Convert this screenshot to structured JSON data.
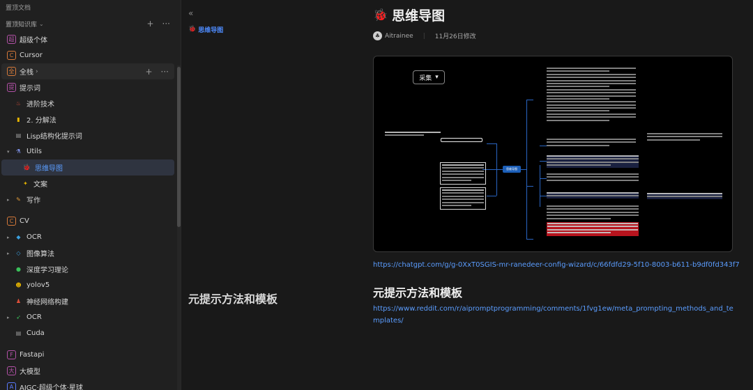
{
  "sidebar": {
    "top_label": "置顶文档",
    "kb_title": "置顶知识库",
    "items": [
      {
        "label": "超级个体",
        "icon": "超",
        "icon_name": "cjgt-kb-icon",
        "color": "#b452a8"
      },
      {
        "label": "Cursor",
        "icon": "C",
        "icon_name": "cursor-kb-icon",
        "color": "#d77a3a"
      },
      {
        "label": "全栈",
        "icon": "全",
        "icon_name": "qz-kb-icon",
        "color": "#d77a3a"
      },
      {
        "label": "提示词",
        "icon": "提",
        "icon_name": "tsc-kb-icon",
        "color": "#b452a8"
      },
      {
        "label": "进阶技术",
        "icon": "♨",
        "icon_name": "fire-icon",
        "color": "#e0503a"
      },
      {
        "label": "2. 分解法",
        "icon": "▮",
        "icon_name": "note-icon",
        "color": "#e6b400"
      },
      {
        "label": "Lisp结构化提示词",
        "icon": "▤",
        "icon_name": "doc-icon",
        "color": "#9a9a9a"
      },
      {
        "label": "Utils",
        "icon": "⚗",
        "icon_name": "flask-icon",
        "color": "#8aa0ff"
      },
      {
        "label": "思维导图",
        "icon": "🐞",
        "icon_name": "ladybug-icon",
        "color": "#e0503a"
      },
      {
        "label": "文案",
        "icon": "✦",
        "icon_name": "sparkle-icon",
        "color": "#e6b400"
      },
      {
        "label": "写作",
        "icon": "✎",
        "icon_name": "camel-icon",
        "color": "#e09a3a"
      },
      {
        "label": "CV",
        "icon": "C",
        "icon_name": "cv-kb-icon",
        "color": "#d77a3a"
      },
      {
        "label": "OCR",
        "icon": "◆",
        "icon_name": "drop-icon",
        "color": "#3aa0e0"
      },
      {
        "label": "图像算法",
        "icon": "◇",
        "icon_name": "shapes-icon",
        "color": "#3aa0e0"
      },
      {
        "label": "深度学习理论",
        "icon": "●",
        "icon_name": "circle-icon",
        "color": "#3ac05a"
      },
      {
        "label": "yolov5",
        "icon": "☻",
        "icon_name": "face-icon",
        "color": "#e6b400"
      },
      {
        "label": "神经网络构建",
        "icon": "♟",
        "icon_name": "bell-icon",
        "color": "#e0503a"
      },
      {
        "label": "OCR",
        "icon": "➶",
        "icon_name": "runner-icon",
        "color": "#3ac05a"
      },
      {
        "label": "Cuda",
        "icon": "▤",
        "icon_name": "doc-icon",
        "color": "#9a9a9a"
      },
      {
        "label": "Fastapi",
        "icon": "F",
        "icon_name": "fastapi-kb-icon",
        "color": "#b452a8"
      },
      {
        "label": "大模型",
        "icon": "大",
        "icon_name": "dmx-kb-icon",
        "color": "#b452a8"
      },
      {
        "label": "AIGC·超级个体·星球",
        "icon": "A",
        "icon_name": "aigc-kb-icon",
        "color": "#5b7bff"
      }
    ]
  },
  "outline": {
    "items": [
      {
        "label": "思维导图",
        "icon": "🐞"
      },
      {
        "label": "元提示方法和模板"
      }
    ]
  },
  "doc": {
    "title": "思维导图",
    "title_icon": "🐞",
    "author": "Aitrainee",
    "date": "11月26日修改",
    "mindmap_button": "采集",
    "mindmap_root": "思维导图",
    "link1": "https://chatgpt.com/g/g-0XxT0SGIS-mr-ranedeer-config-wizard/c/66fdfd29-5f10-8003-b611-b9df0fd343f7",
    "section2_title": "元提示方法和模板",
    "link2": "https://www.reddit.com/r/aipromptprogramming/comments/1fvg1ew/meta_prompting_methods_and_templates/"
  }
}
